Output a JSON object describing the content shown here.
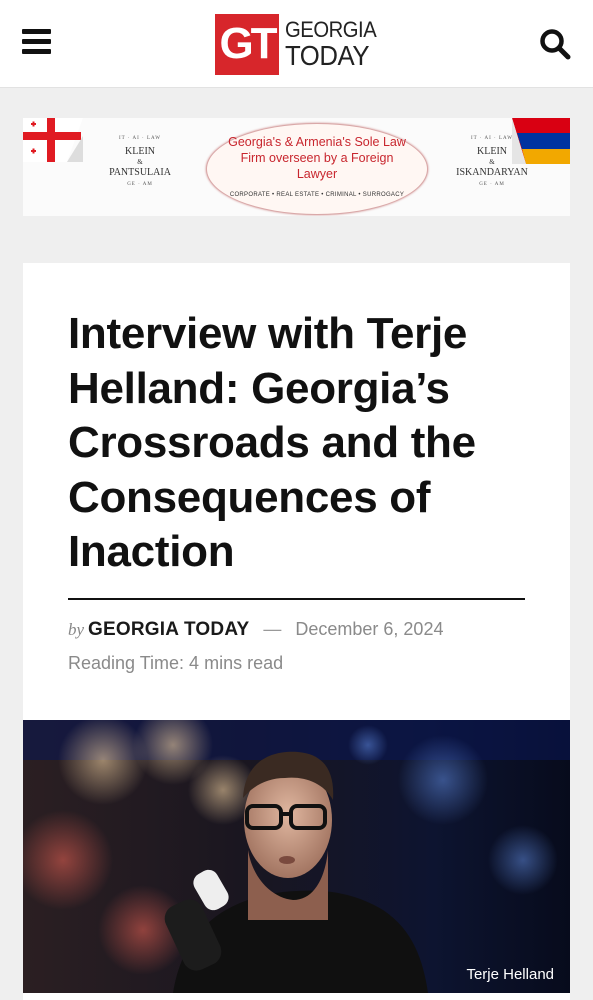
{
  "header": {
    "logo_mark": "GT",
    "logo_line1": "GEORGIA",
    "logo_line2": "TODAY",
    "menu_icon": "hamburger-menu-icon",
    "search_icon": "search-icon",
    "accent": "#d7262b"
  },
  "ad": {
    "left_firm": {
      "tag": "IT · AI · LAW",
      "name1": "KLEIN",
      "amp": "&",
      "name2": "PANTSULAIA",
      "codes": "GE · AM"
    },
    "right_firm": {
      "tag": "IT · AI · LAW",
      "name1": "KLEIN",
      "amp": "&",
      "name2": "ISKANDARYAN",
      "codes": "GE · AM"
    },
    "headline": "Georgia's & Armenia's Sole Law Firm overseen by a Foreign Lawyer",
    "practice_areas": "CORPORATE • REAL ESTATE • CRIMINAL • SURROGACY"
  },
  "article": {
    "title": "Interview with Terje Helland: Georgia’s Crossroads and the Consequences of Inaction",
    "by": "by",
    "author": "GEORGIA TODAY",
    "dash": "—",
    "date": "December 6, 2024",
    "reading_time": "Reading Time: 4 mins read",
    "image_caption": "Terje Helland"
  }
}
